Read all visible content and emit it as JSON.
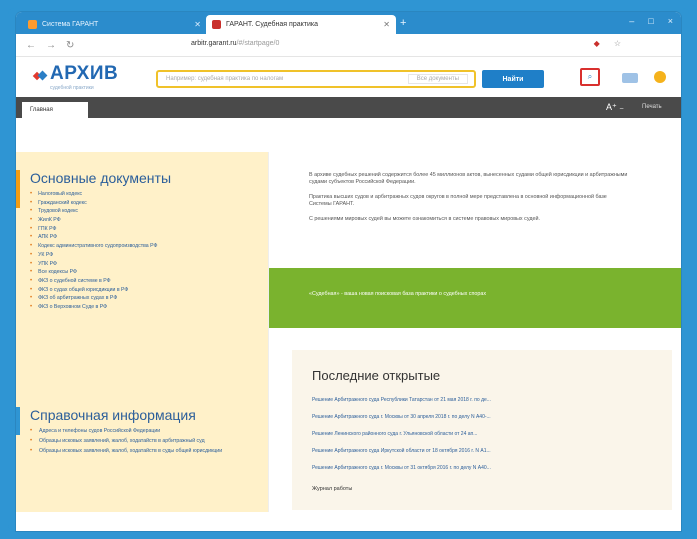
{
  "browser": {
    "tabs": [
      {
        "title": "Система ГАРАНТ"
      },
      {
        "title": "ГАРАНТ. Судебная практика"
      }
    ],
    "new_tab": "+",
    "url_host": "arbitr.garant.ru",
    "url_path": "/#/startpage/0",
    "win_controls": [
      "–",
      "□",
      "×"
    ]
  },
  "header": {
    "logo": "АРХИВ",
    "logo_sub": "судебной практики",
    "search_placeholder": "Например: судебная практика по налогам",
    "search_select": "Все документы",
    "search_button": "Найти"
  },
  "navbar": {
    "home_tab": "Главная",
    "font_control": "A⁺ ₋",
    "print": "Печать"
  },
  "sidebar": {
    "main_docs_title": "Основные документы",
    "main_docs": [
      "Налоговый кодекс",
      "Гражданский кодекс",
      "Трудовой кодекс",
      "ЖилК РФ",
      "ГПК РФ",
      "АПК РФ",
      "Кодекс административного судопроизводства РФ",
      "УК РФ",
      "УПК РФ",
      "Все кодексы РФ",
      "ФКЗ о судебной системе в РФ",
      "ФКЗ о судах общей юрисдикции в РФ",
      "ФКЗ об арбитражных судах в РФ",
      "ФКЗ о Верховном Суде в РФ"
    ],
    "ref_title": "Справочная информация",
    "ref_items": [
      "Адреса и телефоны судов Российской Федерации",
      "Образцы исковых заявлений, жалоб, ходатайств в арбитражный суд",
      "Образцы исковых заявлений, жалоб, ходатайств в суды общей юрисдикции"
    ]
  },
  "main": {
    "intro": [
      "В архиве судебных решений содержится более 45 миллионов актов, вынесенных судами общей юрисдикции и арбитражными судами субъектов Российской Федерации.",
      "Практика высших судов и арбитражных судов округов в полной мере представлена в основной информационной базе Системы ГАРАНТ.",
      "С решениями мировых судей вы можете ознакомиться в системе правовых мировых судей."
    ],
    "green_banner": "«Судебная» - ваша новая поисковая база практики о судебных спорах",
    "recent_title": "Последние открытые",
    "recent_items": [
      "Решение Арбитражного суда Республики Татарстан от 21 мая 2018 г. по де...",
      "Решение Арбитражного суда г. Москвы от 30 апреля 2018 г. по делу N А40-...",
      "Решение Ленинского районного суда г. Ульяновской области от 24 ап...",
      "Решение Арбитражного суда Иркутской области от 18 октября 2016 г. N А1...",
      "Решение Арбитражного суда г. Москвы от 31 октября 2016 г. по делу N А40..."
    ],
    "journal": "Журнал работы"
  }
}
